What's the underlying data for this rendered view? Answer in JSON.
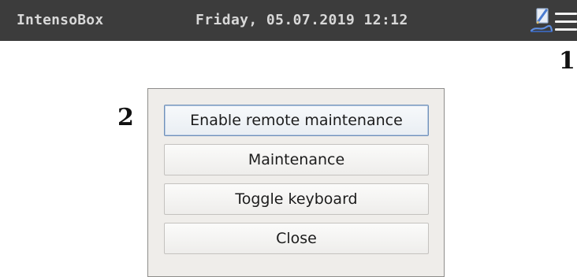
{
  "topbar": {
    "app_title": "IntensoBox",
    "datetime": "Friday, 05.07.2019 12:12",
    "icons": [
      "pen-icon",
      "hamburger-menu-icon"
    ]
  },
  "callouts": [
    "1",
    "2"
  ],
  "menu": {
    "items": [
      {
        "label": "Enable remote maintenance",
        "focused": true
      },
      {
        "label": "Maintenance"
      },
      {
        "label": "Toggle keyboard"
      },
      {
        "label": "Close"
      }
    ]
  },
  "colors": {
    "topbar_bg": "#3c3c3c",
    "topbar_text": "#d8d8d8",
    "panel_bg": "#efedea",
    "focus_border": "#6f8fb8"
  }
}
